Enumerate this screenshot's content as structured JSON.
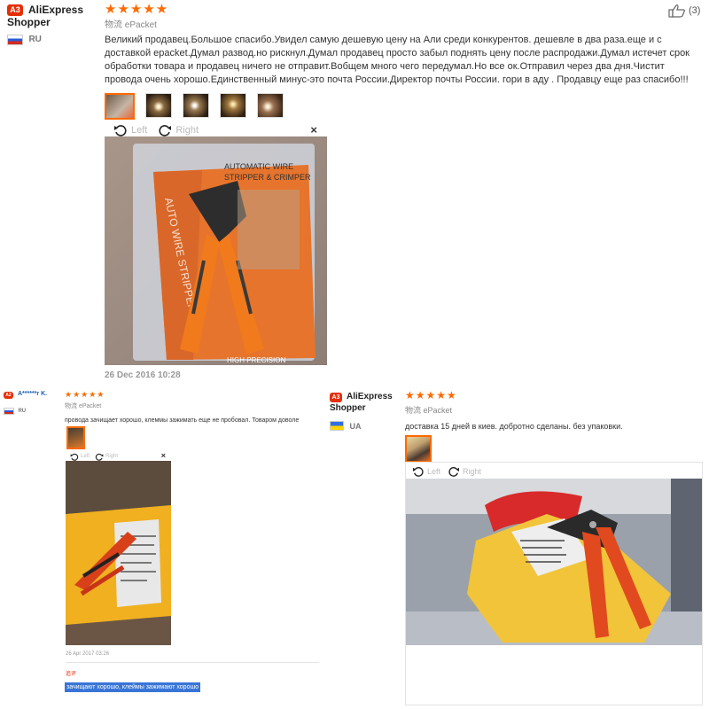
{
  "review1": {
    "badge": "A3",
    "user": "AliExpress Shopper",
    "country": "RU",
    "stars": "★★★★★",
    "shipping_label": "物流",
    "shipping_value": "ePacket",
    "likes": "(3)",
    "text": "Великий продавец.Большое спасибо.Увидел самую дешевую цену на Али среди конкурентов. дешевле в два раза.еще и с доставкой epacket.Думал развод.но рискнул.Думал продавец просто забыл поднять цену после распродажи.Думал истечет срок обработки товара и продавец ничего не отправит.Вобщем много чего передумал.Но все ок.Отправил через два дня.Чистит провода очень хорошо.Единственный минус-это почта России.Директор почты России. гори в аду . Продавцу еще раз спасибо!!!",
    "viewer_left": "Left",
    "viewer_right": "Right",
    "close": "×",
    "package_text_1": "AUTOMATIC WIRE",
    "package_text_2": "STRIPPER & CRIMPER",
    "package_text_3": "AUTO WIRE STRIPPER",
    "package_text_4": "HIGH PRECISION",
    "date": "26 Dec 2016 10:28"
  },
  "review2": {
    "badge": "A2",
    "user": "A******r K.",
    "country": "RU",
    "stars": "★★★★★",
    "shipping_label": "物流",
    "shipping_value": "ePacket",
    "text": "провода зачищает хорошо, клеммы зажимать еще не пробовал. Товаром доволе",
    "viewer_left": "Left",
    "viewer_right": "Right",
    "close": "×",
    "date": "26 Apr 2017 03:26",
    "followup_label": "追评",
    "followup_text": "зачищают хорошо, клеймы зажимают хорошо"
  },
  "review3": {
    "badge": "A3",
    "user": "AliExpress Shopper",
    "country": "UA",
    "stars": "★★★★★",
    "shipping_label": "物流",
    "shipping_value": "ePacket",
    "text": "доставка 15 дней в киев. добротно сделаны. без упаковки.",
    "viewer_left": "Left",
    "viewer_right": "Right"
  },
  "icons": {
    "rotate_left": "rotate-left-icon",
    "rotate_right": "rotate-right-icon",
    "thumbs_up": "thumbs-up-icon"
  },
  "colors": {
    "accent": "#ff6a00",
    "badge": "#e62e04",
    "highlight": "#3875d7"
  }
}
